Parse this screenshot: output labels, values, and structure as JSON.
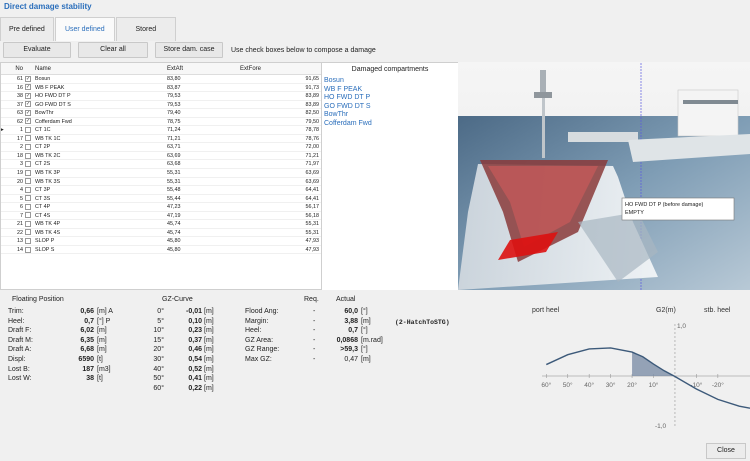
{
  "window": {
    "title": "Direct damage stability"
  },
  "tabs": [
    {
      "label": "Pre defined",
      "active": false
    },
    {
      "label": "User defined",
      "active": true
    },
    {
      "label": "Stored",
      "active": false
    }
  ],
  "toolbar": {
    "evaluate": "Evaluate",
    "clear_all": "Clear all",
    "store": "Store dam. case",
    "hint": "Use check boxes below to compose a damage"
  },
  "grid": {
    "headers": {
      "no": "No",
      "name": "Name",
      "extent_aft": "ExtAft",
      "extent_fore": "ExtFore"
    },
    "rows": [
      {
        "no": "61",
        "checked": true,
        "name": "Bosun",
        "aft": "83,80",
        "fore": "91,65"
      },
      {
        "no": "16",
        "checked": true,
        "name": "WB F PEAK",
        "aft": "83,87",
        "fore": "91,73"
      },
      {
        "no": "38",
        "checked": true,
        "name": "HO FWD DT P",
        "aft": "79,53",
        "fore": "83,89"
      },
      {
        "no": "37",
        "checked": true,
        "name": "GO FWD DT S",
        "aft": "79,53",
        "fore": "83,89"
      },
      {
        "no": "63",
        "checked": true,
        "name": "BowThr",
        "aft": "79,40",
        "fore": "82,50"
      },
      {
        "no": "62",
        "checked": true,
        "name": "Cofferdam Fwd",
        "aft": "78,75",
        "fore": "79,50"
      },
      {
        "no": "1",
        "checked": false,
        "name": "CT 1C",
        "aft": "71,24",
        "fore": "78,78"
      },
      {
        "no": "17",
        "checked": false,
        "name": "WB TK 1C",
        "aft": "71,21",
        "fore": "78,76"
      },
      {
        "no": "2",
        "checked": false,
        "name": "CT 2P",
        "aft": "63,71",
        "fore": "72,00"
      },
      {
        "no": "18",
        "checked": false,
        "name": "WB TK 2C",
        "aft": "63,69",
        "fore": "71,21"
      },
      {
        "no": "3",
        "checked": false,
        "name": "CT 2S",
        "aft": "63,68",
        "fore": "71,97"
      },
      {
        "no": "19",
        "checked": false,
        "name": "WB TK 3P",
        "aft": "55,31",
        "fore": "63,69"
      },
      {
        "no": "20",
        "checked": false,
        "name": "WB TK 3S",
        "aft": "55,31",
        "fore": "63,69"
      },
      {
        "no": "4",
        "checked": false,
        "name": "CT 3P",
        "aft": "55,48",
        "fore": "64,41"
      },
      {
        "no": "5",
        "checked": false,
        "name": "CT 3S",
        "aft": "55,44",
        "fore": "64,41"
      },
      {
        "no": "6",
        "checked": false,
        "name": "CT 4P",
        "aft": "47,23",
        "fore": "56,17"
      },
      {
        "no": "7",
        "checked": false,
        "name": "CT 4S",
        "aft": "47,19",
        "fore": "56,18"
      },
      {
        "no": "21",
        "checked": false,
        "name": "WB TK 4P",
        "aft": "45,74",
        "fore": "55,31"
      },
      {
        "no": "22",
        "checked": false,
        "name": "WB TK 4S",
        "aft": "45,74",
        "fore": "55,31"
      },
      {
        "no": "13",
        "checked": false,
        "name": "SLOP P",
        "aft": "45,80",
        "fore": "47,93"
      },
      {
        "no": "14",
        "checked": false,
        "name": "SLOP S",
        "aft": "45,80",
        "fore": "47,93"
      }
    ]
  },
  "damaged_compartments": {
    "title": "Damaged compartments",
    "items": [
      "Bosun",
      "WB F PEAK",
      "HO FWD DT P",
      "GO FWD DT S",
      "BowThr",
      "Cofferdam Fwd"
    ]
  },
  "view3d": {
    "tooltip_line1": "HO FWD DT P (before damage)",
    "tooltip_line2": "EMPTY"
  },
  "floating": {
    "title": "Floating Position",
    "rows": [
      {
        "label": "Trim:",
        "value": "0,66",
        "unit": "[m] A"
      },
      {
        "label": "Heel:",
        "value": "0,7",
        "unit": "[°] P"
      },
      {
        "label": "Draft F:",
        "value": "6,02",
        "unit": "[m]"
      },
      {
        "label": "Draft M:",
        "value": "6,35",
        "unit": "[m]"
      },
      {
        "label": "Draft A:",
        "value": "6,68",
        "unit": "[m]"
      },
      {
        "label": "Displ:",
        "value": "6590",
        "unit": "[t]"
      },
      {
        "label": "Lost B:",
        "value": "187",
        "unit": "[m3]"
      },
      {
        "label": "Lost W:",
        "value": "38",
        "unit": "[t]"
      }
    ]
  },
  "gzcurve": {
    "title": "GZ-Curve",
    "rows": [
      {
        "angle": "0°",
        "value": "-0,01",
        "unit": "[m]"
      },
      {
        "angle": "5°",
        "value": "0,10",
        "unit": "[m]"
      },
      {
        "angle": "10°",
        "value": "0,23",
        "unit": "[m]"
      },
      {
        "angle": "15°",
        "value": "0,37",
        "unit": "[m]"
      },
      {
        "angle": "20°",
        "value": "0,46",
        "unit": "[m]"
      },
      {
        "angle": "30°",
        "value": "0,54",
        "unit": "[m]"
      },
      {
        "angle": "40°",
        "value": "0,52",
        "unit": "[m]"
      },
      {
        "angle": "50°",
        "value": "0,41",
        "unit": "[m]"
      },
      {
        "angle": "60°",
        "value": "0,22",
        "unit": "[m]"
      }
    ]
  },
  "criteria": {
    "req_header": "Req.",
    "actual_header": "Actual",
    "rows": [
      {
        "label": "Flood Ang:",
        "req": "-",
        "value": "60,0",
        "unit": "[°]"
      },
      {
        "label": "Margin:",
        "req": "-",
        "value": "3,88",
        "unit": "[m]"
      },
      {
        "label": "Heel:",
        "req": "-",
        "value": "0,7",
        "unit": "[°]"
      },
      {
        "label": "GZ Area:",
        "req": "-",
        "value": "0,0868",
        "unit": "[m.rad]"
      },
      {
        "label": "GZ Range:",
        "req": "-",
        "value": ">59,3",
        "unit": "[°]"
      },
      {
        "label": "Max GZ:",
        "req": "-",
        "value": "0,47",
        "unit": "[m]"
      }
    ],
    "note": "(2-HatchToSTG)"
  },
  "chart_data": {
    "type": "line",
    "title": "",
    "left_label": "port heel",
    "center_label": "G2(m)",
    "right_label": "stb. heel",
    "ylim": [
      -1.0,
      1.0
    ],
    "ytick_labels": [
      "1,0",
      "-1,0"
    ],
    "x_tick_labels": [
      "60°",
      "50°",
      "40°",
      "30°",
      "20°",
      "10°",
      "-10°",
      "-20°"
    ],
    "x_ticks": [
      60,
      50,
      40,
      30,
      20,
      10,
      -10,
      -20
    ],
    "xlim": [
      62,
      -35
    ],
    "series": [
      {
        "x": [
          60,
          50,
          40,
          30,
          20,
          15,
          10,
          5,
          0,
          -10,
          -20,
          -30,
          -35
        ],
        "y": [
          0.22,
          0.41,
          0.52,
          0.54,
          0.46,
          0.37,
          0.23,
          0.1,
          -0.01,
          -0.25,
          -0.45,
          -0.58,
          -0.62
        ]
      }
    ],
    "shaded_range": [
      0,
      20
    ]
  },
  "footer": {
    "close": "Close"
  }
}
